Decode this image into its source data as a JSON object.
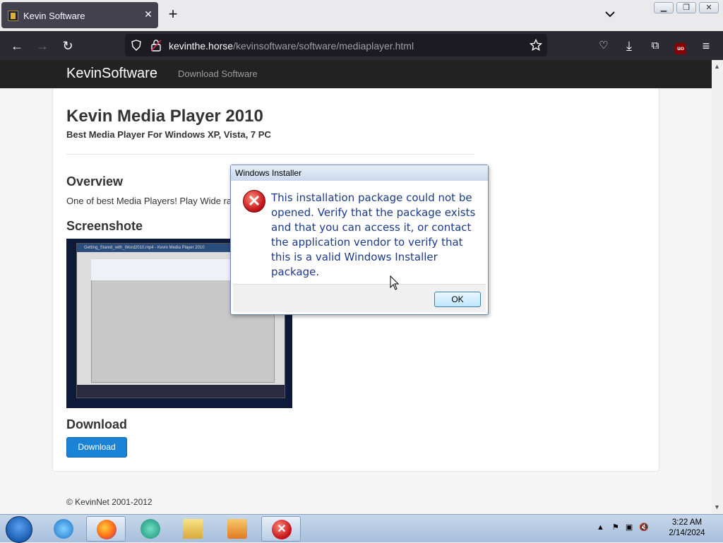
{
  "browser": {
    "tab_title": "Kevin Software",
    "url_host": "kevinthe.horse",
    "url_path": "/kevinsoftware/software/mediaplayer.html"
  },
  "site": {
    "brand": "KevinSoftware",
    "nav_download": "Download Software",
    "title": "Kevin Media Player 2010",
    "subtitle": "Best Media Player For Windows XP, Vista, 7 PC",
    "overview_heading": "Overview",
    "overview_text": "One of best Media Players! Play Wide range of media formats.",
    "screenshot_heading": "Screenshote",
    "screenshot_window_title": "Getting_Stared_with_Word2010.mp4 - Kevin Media Player 2010",
    "download_heading": "Download",
    "download_button": "Download",
    "footer": "© KevinNet 2001-2012"
  },
  "dialog": {
    "title": "Windows Installer",
    "message": "This installation package could not be opened.  Verify that the package exists and that you can access it, or contact the application vendor to verify that this is a valid Windows Installer package.",
    "ok_label": "OK"
  },
  "taskbar": {
    "time": "3:22 AM",
    "date": "2/14/2024"
  }
}
